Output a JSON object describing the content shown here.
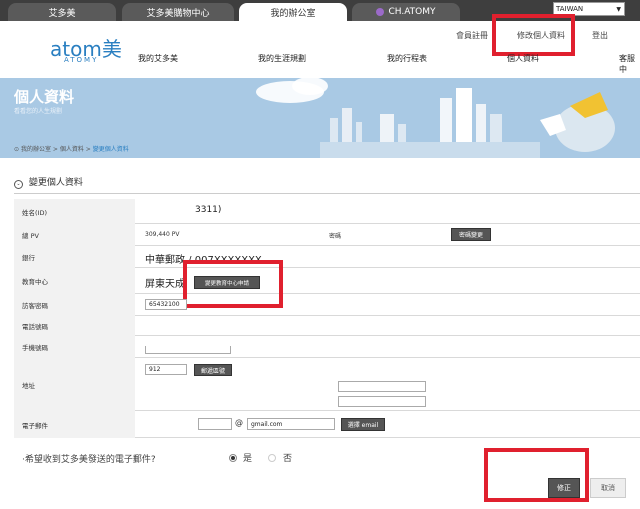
{
  "top_tabs": [
    "艾多美",
    "艾多美購物中心",
    "我的辦公室",
    "CH.ATOMY"
  ],
  "region": "TAIWAN",
  "logo": {
    "text": "atom美",
    "sub": "ATOMY"
  },
  "header": {
    "util_links": [
      "會員註冊",
      "修改個人資料",
      "登出"
    ],
    "nav": [
      "我的艾多美",
      "我的生涯規劃",
      "我的行程表",
      "個人資料",
      "客服中"
    ]
  },
  "banner": {
    "title": "個人資料",
    "subtitle": "看看您的人生規劃"
  },
  "breadcrumb": {
    "items": [
      "我的辦公室",
      "個人資料"
    ],
    "current": "變更個人資料",
    "sep": ">"
  },
  "section_title": "變更個人資料",
  "form": {
    "name_label": "姓名(ID)",
    "name_value": "3311)",
    "pv_label": "總 PV",
    "pv_value": "309,440 PV",
    "password_label": "密碼",
    "password_button": "密碼變更",
    "bank_label": "銀行",
    "bank_value": "中華郵政 / 007XXXXXXX",
    "edu_label": "教育中心",
    "edu_value": "屏東天成",
    "edu_button": "變更教育中心申請",
    "visitor_label": "訪客密碼",
    "visitor_value": "65432100",
    "phone_label": "電話號碼",
    "mobile_label": "手機號碼",
    "address_label": "地址",
    "zip_value": "912",
    "zip_button": "郵遞區號",
    "email_label": "電子郵件",
    "email_at": "@",
    "email_domain": "gmail.com",
    "email_button": "選擇 email"
  },
  "newsletter": {
    "question": "·希望收到艾多美發送的電子郵件?",
    "yes": "是",
    "no": "否",
    "selected": "yes"
  },
  "actions": {
    "submit": "修正",
    "cancel": "取消"
  }
}
